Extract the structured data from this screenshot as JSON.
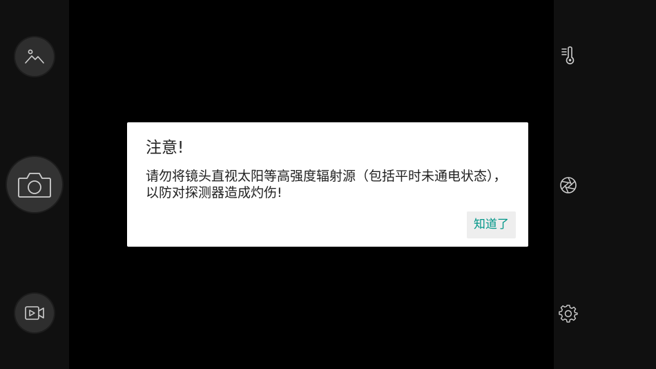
{
  "dialog": {
    "title": "注意!",
    "message": "请勿将镜头直视太阳等高强度辐射源（包括平时未通电状态），以防对探测器造成灼伤!",
    "confirm_label": "知道了"
  },
  "left_toolbar": {
    "gallery_icon": "mountain-image-icon",
    "shutter_icon": "camera-icon",
    "video_icon": "video-camera-icon"
  },
  "right_toolbar": {
    "temperature_icon": "thermometer-icon",
    "aperture_icon": "aperture-icon",
    "settings_icon": "gear-icon"
  },
  "colors": {
    "background": "#000000",
    "side_bar": "#101010",
    "button_fill": "#2e2e2e",
    "icon_stroke": "#cfcfcf",
    "dialog_bg": "#ffffff",
    "accent": "#009688"
  }
}
